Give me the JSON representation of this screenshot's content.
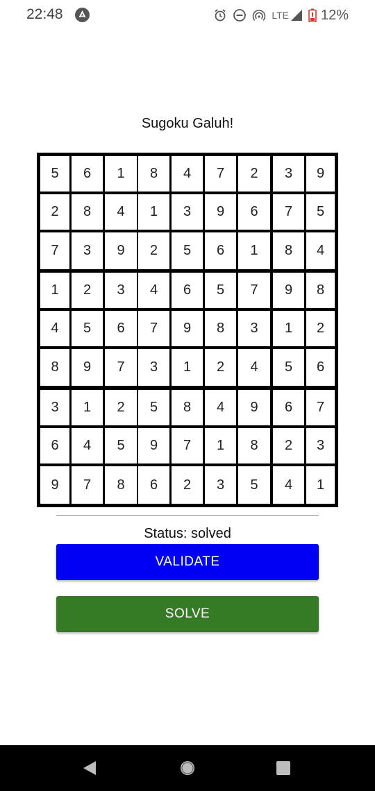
{
  "status_bar": {
    "time": "22:48",
    "network": "LTE",
    "battery": "12%",
    "icons": [
      "app-notification-icon",
      "alarm-icon",
      "do-not-disturb-icon",
      "hotspot-icon",
      "signal-icon",
      "battery-icon"
    ]
  },
  "app": {
    "title": "Sugoku Galuh!",
    "status_text": "Status: solved",
    "validate_label": "VALIDATE",
    "solve_label": "SOLVE"
  },
  "colors": {
    "validate_button": "#0000f5",
    "solve_button": "#357a25",
    "grid_border": "#000000"
  },
  "board": [
    [
      5,
      6,
      1,
      8,
      4,
      7,
      2,
      3,
      9
    ],
    [
      2,
      8,
      4,
      1,
      3,
      9,
      6,
      7,
      5
    ],
    [
      7,
      3,
      9,
      2,
      5,
      6,
      1,
      8,
      4
    ],
    [
      1,
      2,
      3,
      4,
      6,
      5,
      7,
      9,
      8
    ],
    [
      4,
      5,
      6,
      7,
      9,
      8,
      3,
      1,
      2
    ],
    [
      8,
      9,
      7,
      3,
      1,
      2,
      4,
      5,
      6
    ],
    [
      3,
      1,
      2,
      5,
      8,
      4,
      9,
      6,
      7
    ],
    [
      6,
      4,
      5,
      9,
      7,
      1,
      8,
      2,
      3
    ],
    [
      9,
      7,
      8,
      6,
      2,
      3,
      5,
      4,
      1
    ]
  ],
  "nav_bar": {
    "icons": [
      "back-icon",
      "home-icon",
      "recents-icon"
    ]
  }
}
